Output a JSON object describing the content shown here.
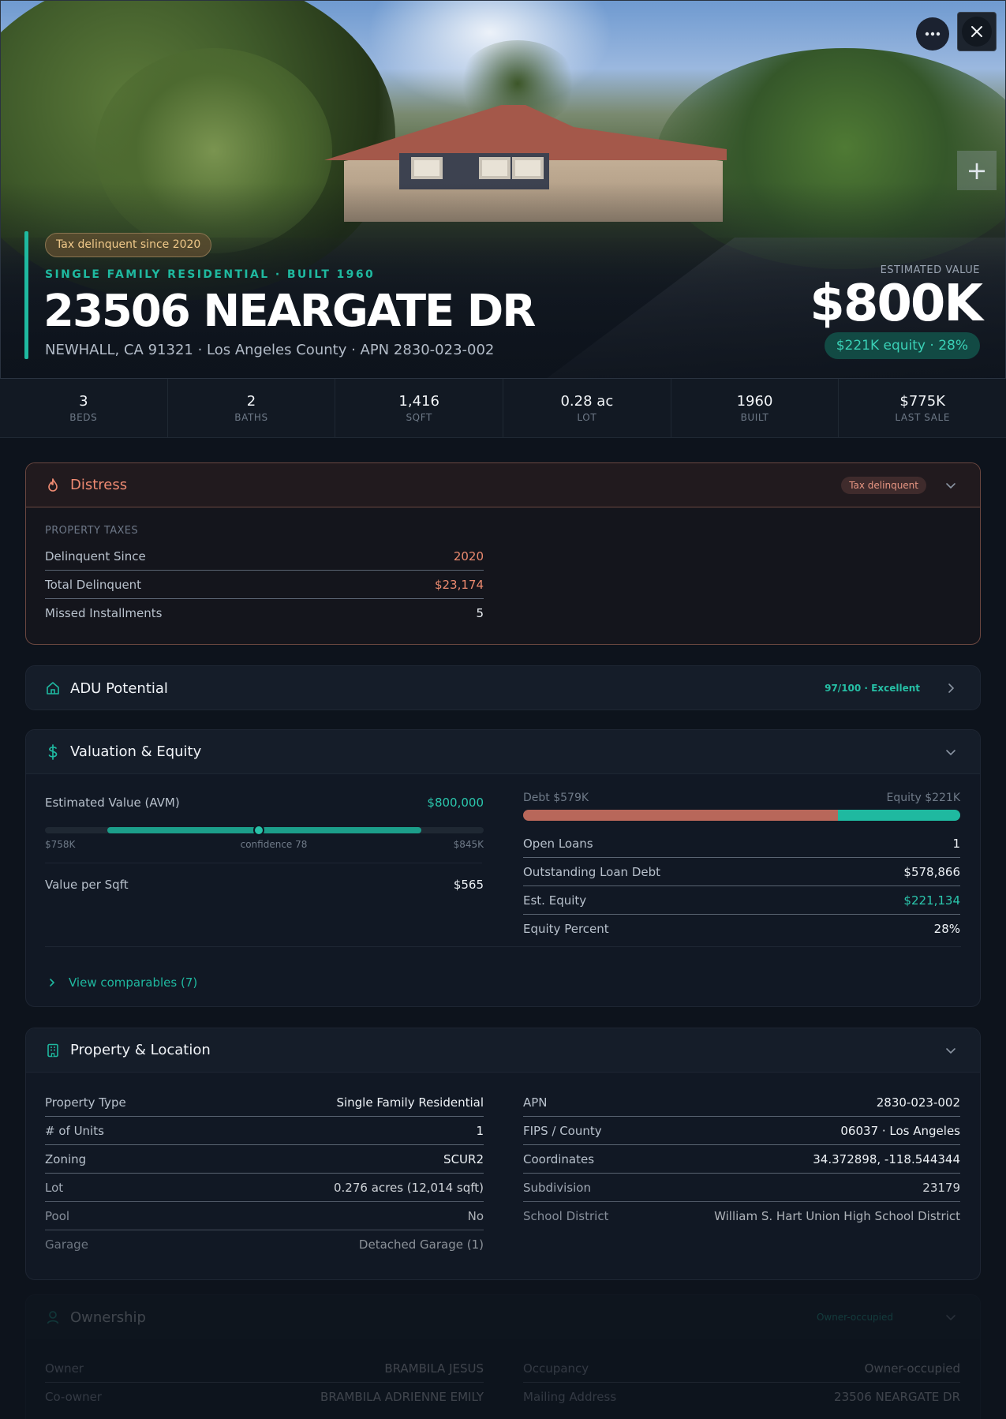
{
  "hero": {
    "badge": "Tax delinquent since 2020",
    "kicker": "SINGLE FAMILY RESIDENTIAL · BUILT 1960",
    "title": "23506 NEARGATE DR",
    "subtitle": "NEWHALL, CA 91321 · Los Angeles County · APN 2830-023-002",
    "estimated_label": "ESTIMATED VALUE",
    "estimated_value": "$800K",
    "equity_chip": "$221K equity · 28%",
    "zoom_label": "+"
  },
  "stats": [
    {
      "value": "3",
      "label": "BEDS"
    },
    {
      "value": "2",
      "label": "BATHS"
    },
    {
      "value": "1,416",
      "label": "SQFT"
    },
    {
      "value": "0.28 ac",
      "label": "LOT"
    },
    {
      "value": "1960",
      "label": "BUILT"
    },
    {
      "value": "$775K",
      "label": "LAST SALE"
    }
  ],
  "distress": {
    "title": "Distress",
    "badge": "Tax delinquent",
    "section_label": "PROPERTY TAXES",
    "rows": [
      {
        "k": "Delinquent Since",
        "v": "2020"
      },
      {
        "k": "Total Delinquent",
        "v": "$23,174"
      },
      {
        "k": "Missed Installments",
        "v": "5"
      }
    ]
  },
  "adu": {
    "title": "ADU Potential",
    "badge": "97/100 · Excellent"
  },
  "valuation": {
    "title": "Valuation & Equity",
    "avm_label": "Estimated Value (AVM)",
    "avm_value": "$800,000",
    "range_low": "$758K",
    "range_high": "$845K",
    "confidence": "confidence 78",
    "range": {
      "low": 758000,
      "high": 845000,
      "estimate": 800000
    },
    "value_per_sqft_label": "Value per Sqft",
    "value_per_sqft": "$565",
    "debt_label": "Debt $579K",
    "equity_label": "Equity $221K",
    "equity_fraction": 0.28,
    "rows": [
      {
        "k": "Open Loans",
        "v": "1"
      },
      {
        "k": "Outstanding Loan Debt",
        "v": "$578,866"
      },
      {
        "k": "Est. Equity",
        "v": "$221,134"
      },
      {
        "k": "Equity Percent",
        "v": "28%"
      }
    ],
    "comparables": "View comparables (7)"
  },
  "property": {
    "title": "Property & Location",
    "left": [
      {
        "k": "Property Type",
        "v": "Single Family Residential"
      },
      {
        "k": "# of Units",
        "v": "1"
      },
      {
        "k": "Zoning",
        "v": "SCUR2"
      },
      {
        "k": "Lot",
        "v": "0.276 acres (12,014 sqft)"
      },
      {
        "k": "Pool",
        "v": "No"
      },
      {
        "k": "Garage",
        "v": "Detached Garage (1)"
      }
    ],
    "right": [
      {
        "k": "APN",
        "v": "2830-023-002"
      },
      {
        "k": "FIPS / County",
        "v": "06037 · Los Angeles"
      },
      {
        "k": "Coordinates",
        "v": "34.372898, -118.544344"
      },
      {
        "k": "Subdivision",
        "v": "23179"
      },
      {
        "k": "School District",
        "v": "William S. Hart Union High School District"
      }
    ]
  },
  "ownership": {
    "title": "Ownership",
    "badge": "Owner-occupied",
    "left": [
      {
        "k": "Owner",
        "v": "BRAMBILA JESUS"
      },
      {
        "k": "Co-owner",
        "v": "BRAMBILA ADRIENNE EMILY"
      }
    ],
    "right": [
      {
        "k": "Occupancy",
        "v": "Owner-occupied"
      },
      {
        "k": "Mailing Address",
        "v": "23506 NEARGATE DR"
      }
    ]
  },
  "colors": {
    "accent": "#1fb9a0",
    "distress": "#ee8a72",
    "debt": "#b8675a",
    "background": "#0d131c"
  },
  "icons": {
    "more": "more-horizontal-icon",
    "close": "close-icon",
    "zoom": "plus-icon",
    "distress": "flame-icon",
    "adu": "home-icon",
    "valuation": "dollar-icon",
    "property": "building-icon",
    "ownership": "user-icon",
    "expand": "chevron-down-icon",
    "open": "chevron-right-icon"
  }
}
